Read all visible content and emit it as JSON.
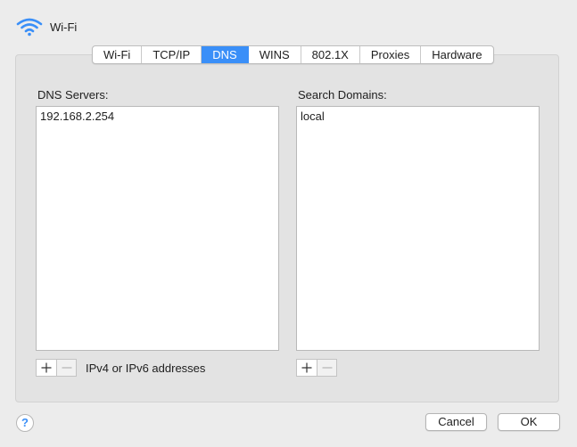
{
  "header": {
    "title": "Wi-Fi",
    "icon": "wifi-icon"
  },
  "tabs": [
    {
      "label": "Wi-Fi",
      "active": false
    },
    {
      "label": "TCP/IP",
      "active": false
    },
    {
      "label": "DNS",
      "active": true
    },
    {
      "label": "WINS",
      "active": false
    },
    {
      "label": "802.1X",
      "active": false
    },
    {
      "label": "Proxies",
      "active": false
    },
    {
      "label": "Hardware",
      "active": false
    }
  ],
  "dns_servers": {
    "label": "DNS Servers:",
    "items": [
      "192.168.2.254"
    ],
    "hint": "IPv4 or IPv6 addresses"
  },
  "search_domains": {
    "label": "Search Domains:",
    "items": [
      "local"
    ]
  },
  "footer": {
    "help": "?",
    "cancel_label": "Cancel",
    "ok_label": "OK"
  },
  "colors": {
    "accent": "#3a8ff8",
    "background": "#ececec"
  }
}
